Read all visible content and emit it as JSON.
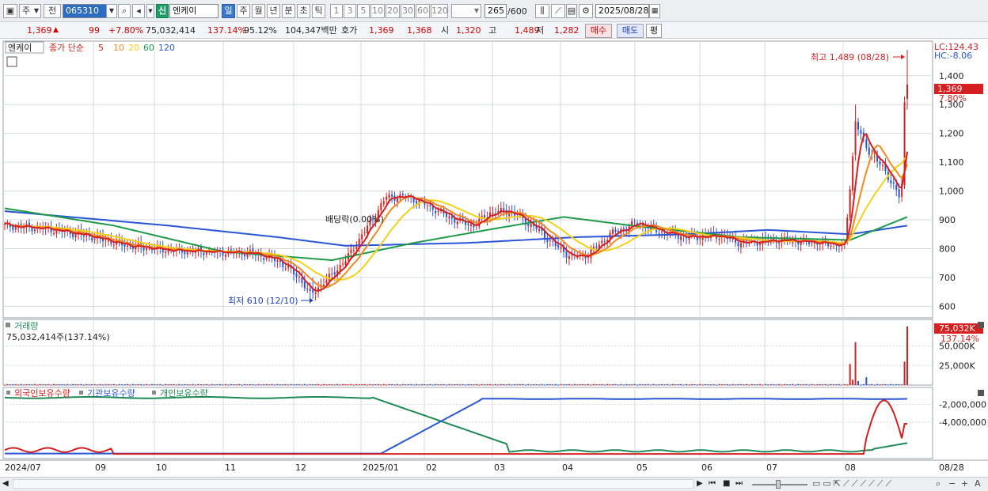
{
  "toolbar": {
    "period_select": "주",
    "mode_select": "전",
    "code": "065310",
    "badge_new": "신",
    "stock_name": "엔케이",
    "period_tabs": [
      "일",
      "주",
      "월",
      "년",
      "분",
      "초",
      "틱"
    ],
    "active_period": "일",
    "interval_buttons": [
      "1",
      "3",
      "5",
      "10",
      "20",
      "30",
      "60",
      "120"
    ],
    "count": "265",
    "count_total": "/600",
    "date": "2025/08/28"
  },
  "quote": {
    "price": "1,369",
    "arrow": "▲",
    "change": "99",
    "change_pct": "+7.80%",
    "volume": "75,032,414",
    "volume_ratio": "137.14%",
    "strength": "95.12%",
    "amount": "104,347백만",
    "ask_label": "호가",
    "ask": "1,369",
    "bid": "1,368",
    "open_label": "시",
    "open": "1,320",
    "high_label": "고",
    "high": "1,489",
    "low_label": "저",
    "low": "1,282",
    "buy_button": "매수",
    "sell_button": "매도",
    "eval_button": "평"
  },
  "price_panel": {
    "title": "엔케이",
    "ma_label": "종가 단순",
    "ma_periods": [
      "5",
      "10",
      "20",
      "60",
      "120"
    ],
    "ma_colors": [
      "#d42020",
      "#f08a1e",
      "#f2d11a",
      "#1e9a48",
      "#2a55d6"
    ],
    "lc": "LC:124.43",
    "hc": "HC:-8.06",
    "high_note": "최고 1,489 (08/28)",
    "low_note": "최저 610 (12/10)",
    "dividend_note": "배당락(0.00%)",
    "price_tag": "1,369",
    "pct_tag": "7.80%"
  },
  "volume_panel": {
    "title": "거래량",
    "value": "75,032,414주(137.14%)",
    "tag": "75,032K",
    "tag_pct": "137.14%"
  },
  "holdings_panel": {
    "titles": [
      "외국인보유수량",
      "기관보유수량",
      "개인보유수량"
    ],
    "colors": [
      "#d42020",
      "#2a55d6",
      "#1e8a55"
    ]
  },
  "chart_data": [
    {
      "type": "line",
      "name": "price",
      "y_ticks": [
        "1,400",
        "1,300",
        "1,200",
        "1,100",
        "1,000",
        "900",
        "800",
        "700",
        "600"
      ],
      "ylim": [
        560,
        1520
      ],
      "x_labels": [
        "2024/07",
        "09",
        "10",
        "11",
        "12",
        "2025/01",
        "02",
        "03",
        "04",
        "05",
        "06",
        "07",
        "08"
      ],
      "end_label": "08/28",
      "close_anchors": [
        [
          0,
          880
        ],
        [
          15,
          870
        ],
        [
          30,
          845
        ],
        [
          45,
          810
        ],
        [
          60,
          795
        ],
        [
          75,
          790
        ],
        [
          90,
          785
        ],
        [
          100,
          760
        ],
        [
          108,
          700
        ],
        [
          112,
          640
        ],
        [
          118,
          690
        ],
        [
          125,
          760
        ],
        [
          132,
          860
        ],
        [
          140,
          980
        ],
        [
          148,
          980
        ],
        [
          155,
          950
        ],
        [
          165,
          900
        ],
        [
          172,
          880
        ],
        [
          178,
          925
        ],
        [
          185,
          930
        ],
        [
          195,
          870
        ],
        [
          202,
          810
        ],
        [
          208,
          770
        ],
        [
          214,
          780
        ],
        [
          222,
          850
        ],
        [
          232,
          890
        ],
        [
          240,
          860
        ],
        [
          250,
          840
        ],
        [
          262,
          845
        ],
        [
          270,
          820
        ],
        [
          285,
          830
        ],
        [
          300,
          820
        ],
        [
          308,
          810
        ],
        [
          311,
          1120
        ],
        [
          312,
          1240
        ],
        [
          316,
          1150
        ],
        [
          322,
          1080
        ],
        [
          326,
          1020
        ],
        [
          328,
          980
        ],
        [
          329,
          1020
        ],
        [
          330,
          1300
        ],
        [
          331,
          1369
        ]
      ],
      "ma120_anchors": [
        [
          0,
          930
        ],
        [
          60,
          880
        ],
        [
          100,
          840
        ],
        [
          125,
          810
        ],
        [
          170,
          820
        ],
        [
          210,
          840
        ],
        [
          250,
          850
        ],
        [
          280,
          865
        ],
        [
          310,
          850
        ],
        [
          331,
          880
        ]
      ],
      "ma60_anchors": [
        [
          0,
          940
        ],
        [
          40,
          880
        ],
        [
          80,
          790
        ],
        [
          120,
          760
        ],
        [
          150,
          820
        ],
        [
          180,
          870
        ],
        [
          205,
          910
        ],
        [
          230,
          880
        ],
        [
          270,
          840
        ],
        [
          310,
          830
        ],
        [
          331,
          910
        ]
      ]
    },
    {
      "type": "bar",
      "name": "volume",
      "y_ticks": [
        "50,000K",
        "25,000K"
      ],
      "ylim": [
        0,
        80000
      ],
      "spikes": [
        [
          310,
          27000
        ],
        [
          311,
          7000
        ],
        [
          312,
          55000
        ],
        [
          313,
          5000
        ],
        [
          316,
          10000
        ],
        [
          330,
          30000
        ],
        [
          331,
          75032
        ]
      ]
    },
    {
      "type": "line",
      "name": "holdings",
      "y_ticks": [
        "-2,000,000",
        "-4,000,000"
      ],
      "ylim": [
        -8000000,
        -400000
      ]
    }
  ],
  "status_bar": {
    "icons": [
      "play-icon",
      "fast-back-icon",
      "stop-icon",
      "fast-forward-icon"
    ]
  }
}
